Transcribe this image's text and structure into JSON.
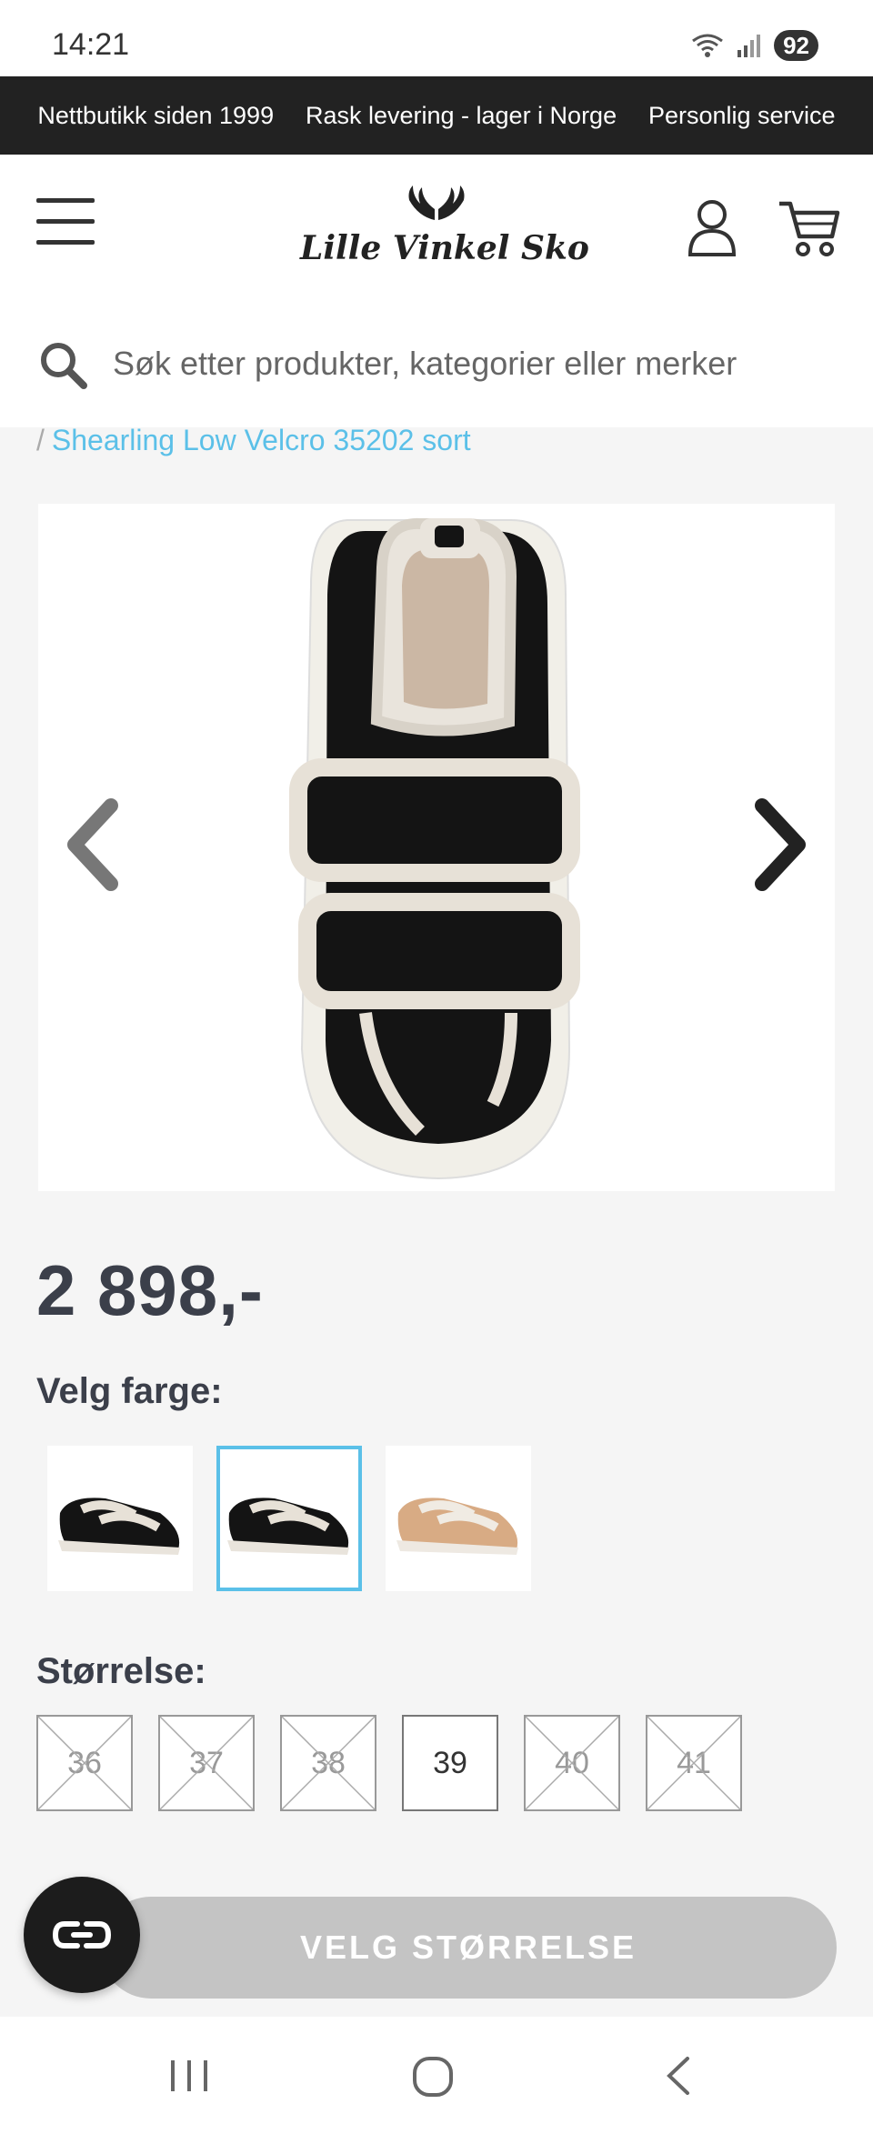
{
  "status_bar": {
    "time": "14:21",
    "battery": "92"
  },
  "promo_bar": {
    "items": [
      "Nettbutikk siden 1999",
      "Rask levering - lager i Norge",
      "Personlig service"
    ]
  },
  "header": {
    "brand": "Lille Vinkel Sko"
  },
  "search": {
    "placeholder": "Søk etter produkter, kategorier eller merker"
  },
  "breadcrumb": {
    "separator": "/",
    "current": "Shearling Low Velcro 35202 sort"
  },
  "product": {
    "price": "2 898,-"
  },
  "color_picker": {
    "label": "Velg farge:",
    "selected_index": 1
  },
  "size_picker": {
    "label": "Størrelse:",
    "sizes": [
      {
        "size": "36",
        "available": false
      },
      {
        "size": "37",
        "available": false
      },
      {
        "size": "38",
        "available": false
      },
      {
        "size": "39",
        "available": true
      },
      {
        "size": "40",
        "available": false
      },
      {
        "size": "41",
        "available": false
      }
    ]
  },
  "cta": {
    "label": "VELG STØRRELSE"
  },
  "colors": {
    "accent": "#5bc0e8",
    "promo_bg": "#222222",
    "cta_disabled": "#c4c4c4",
    "text_dark": "#3b3f4a"
  }
}
